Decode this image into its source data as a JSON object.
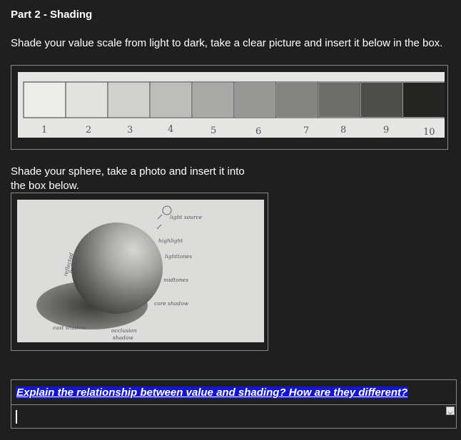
{
  "part_heading": "Part 2 - Shading",
  "instruction_scale": "Shade your value scale from light to dark, take a clear picture and insert it below in the box.",
  "value_scale_numbers": [
    "1",
    "2",
    "3",
    "4",
    "5",
    "6",
    "7",
    "8",
    "9",
    "10"
  ],
  "instruction_sphere": "Shade your sphere, take a photo and insert it into the box below.",
  "sphere_labels": {
    "light_source": "light source",
    "highlight": "highlight",
    "lighttones": "lighttones",
    "midtones": "midtones",
    "core_shadow": "core shadow",
    "reflected_light_a": "reflected",
    "reflected_light_b": "light",
    "cast_shadow": "cast shadow",
    "occlusion_a": "occlusion",
    "occlusion_b": "shadow"
  },
  "question": "Explain the relationship between value and shading?  How are they different?",
  "answer_text": ""
}
